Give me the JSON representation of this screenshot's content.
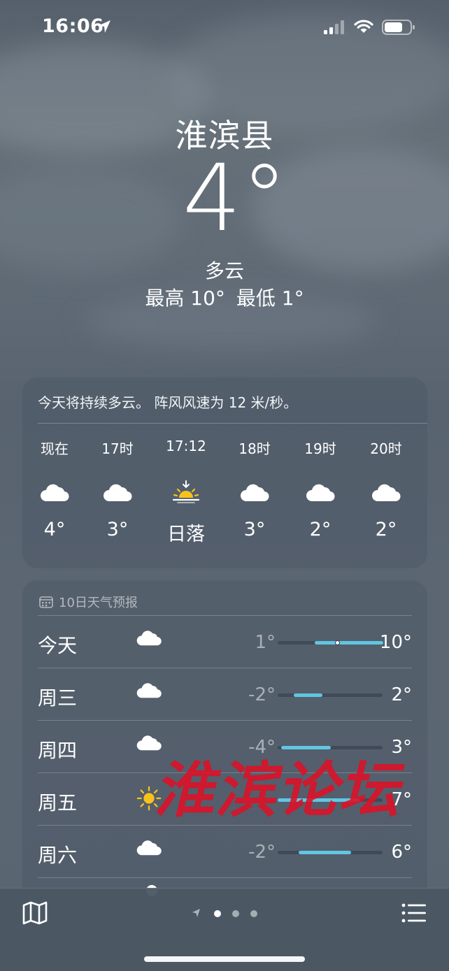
{
  "status_bar": {
    "time": "16:06"
  },
  "current": {
    "city": "淮滨县",
    "temperature": "4°",
    "condition": "多云",
    "high": "最高 10°",
    "low": "最低 1°"
  },
  "hourly": {
    "summary": "今天将持续多云。 阵风风速为 12 米/秒。",
    "items": [
      {
        "label": "现在",
        "icon": "cloud-icon",
        "value": "4°"
      },
      {
        "label": "17时",
        "icon": "cloud-icon",
        "value": "3°"
      },
      {
        "label": "17:12",
        "icon": "sunset-icon",
        "value": "日落"
      },
      {
        "label": "18时",
        "icon": "cloud-icon",
        "value": "3°"
      },
      {
        "label": "19时",
        "icon": "cloud-icon",
        "value": "2°"
      },
      {
        "label": "20时",
        "icon": "cloud-icon",
        "value": "2°"
      }
    ]
  },
  "daily": {
    "title": "10日天气预报",
    "days": [
      {
        "day": "今天",
        "icon": "cloud-icon",
        "low": "1°",
        "high": "10°",
        "range_start": 0.35,
        "range_end": 1.0,
        "current_marker": 0.57
      },
      {
        "day": "周三",
        "icon": "cloud-icon",
        "low": "-2°",
        "high": "2°",
        "range_start": 0.15,
        "range_end": 0.42
      },
      {
        "day": "周四",
        "icon": "cloud-icon",
        "low": "-4°",
        "high": "3°",
        "range_start": 0.03,
        "range_end": 0.5
      },
      {
        "day": "周五",
        "icon": "sun-icon",
        "low": "",
        "high": "7°",
        "range_start": 0.0,
        "range_end": 0.78
      },
      {
        "day": "周六",
        "icon": "cloud-icon",
        "low": "-2°",
        "high": "6°",
        "range_start": 0.2,
        "range_end": 0.7
      }
    ]
  },
  "watermark": "淮滨论坛",
  "colors": {
    "bar": "#60c6e2",
    "sun": "#f7c21c",
    "watermark": "#dc1228"
  }
}
